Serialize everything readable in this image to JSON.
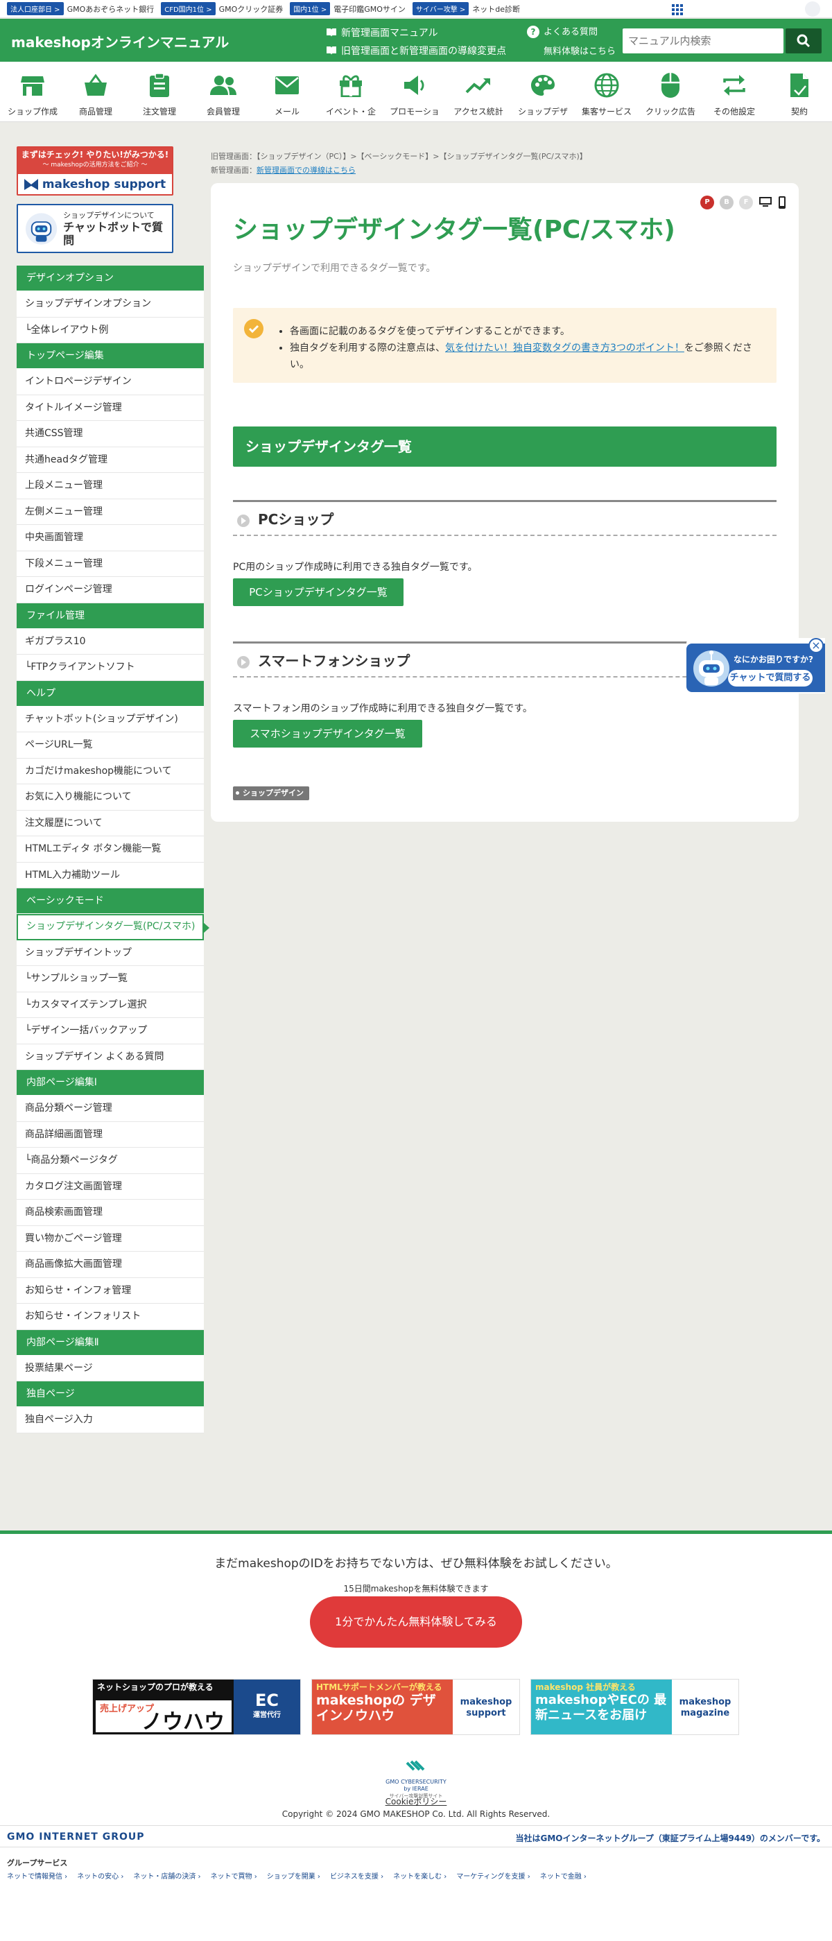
{
  "topbar": {
    "items": [
      {
        "badge": "法人口座部日 >",
        "label": "GMOあおぞらネット銀行"
      },
      {
        "badge": "CFD国内1位 >",
        "label": "GMOクリック証券"
      },
      {
        "badge": "国内1位 >",
        "label": "電子印鑑GMOサイン"
      },
      {
        "badge": "サイバー攻撃 >",
        "label": "ネットde診断"
      }
    ]
  },
  "header": {
    "logo": "makeshopオンラインマニュアル",
    "link1": "新管理画面マニュアル",
    "link2": "旧管理画面と新管理画面の導線変更点",
    "faq": "よくある質問",
    "trial": "無料体験はこちら",
    "search_placeholder": "マニュアル内検索"
  },
  "nav": [
    {
      "label": "ショップ作成",
      "icon": "shop-icon"
    },
    {
      "label": "商品管理",
      "icon": "basket-icon"
    },
    {
      "label": "注文管理",
      "icon": "clipboard-icon"
    },
    {
      "label": "会員管理",
      "icon": "users-icon"
    },
    {
      "label": "メール",
      "icon": "mail-icon"
    },
    {
      "label": "イベント・企",
      "icon": "gift-icon"
    },
    {
      "label": "プロモーショ",
      "icon": "megaphone-icon"
    },
    {
      "label": "アクセス統計",
      "icon": "chart-icon"
    },
    {
      "label": "ショップデザ",
      "icon": "palette-icon"
    },
    {
      "label": "集客サービス",
      "icon": "globe-icon"
    },
    {
      "label": "クリック広告",
      "icon": "mouse-icon"
    },
    {
      "label": "その他設定",
      "icon": "arrows-icon"
    },
    {
      "label": "契約",
      "icon": "document-icon"
    }
  ],
  "banners": {
    "support_top": "まずはチェック! やりたい!がみつかる!",
    "support_sub": "～ makeshopの活用方法をご紹介 ～",
    "support_logo": "makeshop support",
    "chat_line1": "ショップデザインについて",
    "chat_line2": "チャットボットで質問"
  },
  "sidebar": [
    {
      "type": "cat",
      "label": "デザインオプション"
    },
    {
      "type": "it",
      "label": "ショップデザインオプション"
    },
    {
      "type": "it",
      "label": "└全体レイアウト例"
    },
    {
      "type": "cat",
      "label": "トップページ編集"
    },
    {
      "type": "it",
      "label": "イントロページデザイン"
    },
    {
      "type": "it",
      "label": "タイトルイメージ管理"
    },
    {
      "type": "it",
      "label": "共通CSS管理"
    },
    {
      "type": "it",
      "label": "共通headタグ管理"
    },
    {
      "type": "it",
      "label": "上段メニュー管理"
    },
    {
      "type": "it",
      "label": "左側メニュー管理"
    },
    {
      "type": "it",
      "label": "中央画面管理"
    },
    {
      "type": "it",
      "label": "下段メニュー管理"
    },
    {
      "type": "it",
      "label": "ログインページ管理"
    },
    {
      "type": "cat",
      "label": "ファイル管理"
    },
    {
      "type": "it",
      "label": "ギガプラス10"
    },
    {
      "type": "it",
      "label": "└FTPクライアントソフト"
    },
    {
      "type": "cat",
      "label": "ヘルプ"
    },
    {
      "type": "it",
      "label": "チャットボット(ショップデザイン)"
    },
    {
      "type": "it",
      "label": "ページURL一覧"
    },
    {
      "type": "it",
      "label": "カゴだけmakeshop機能について"
    },
    {
      "type": "it",
      "label": "お気に入り機能について"
    },
    {
      "type": "it",
      "label": "注文履歴について"
    },
    {
      "type": "it",
      "label": "HTMLエディタ ボタン機能一覧"
    },
    {
      "type": "it",
      "label": "HTML入力補助ツール"
    },
    {
      "type": "cat",
      "label": "ベーシックモード"
    },
    {
      "type": "act",
      "label": "ショップデザインタグ一覧(PC/スマホ)"
    },
    {
      "type": "it",
      "label": "ショップデザイントップ"
    },
    {
      "type": "it",
      "label": "└サンプルショップ一覧"
    },
    {
      "type": "it",
      "label": "└カスタマイズテンプレ選択"
    },
    {
      "type": "it",
      "label": "└デザイン一括バックアップ"
    },
    {
      "type": "it",
      "label": "ショップデザイン よくある質問"
    },
    {
      "type": "cat",
      "label": "内部ページ編集Ⅰ"
    },
    {
      "type": "it",
      "label": "商品分類ページ管理"
    },
    {
      "type": "it",
      "label": "商品詳細画面管理"
    },
    {
      "type": "it",
      "label": "└商品分類ページタグ"
    },
    {
      "type": "it",
      "label": "カタログ注文画面管理"
    },
    {
      "type": "it",
      "label": "商品検索画面管理"
    },
    {
      "type": "it",
      "label": "買い物かごページ管理"
    },
    {
      "type": "it",
      "label": "商品画像拡大画面管理"
    },
    {
      "type": "it",
      "label": "お知らせ・インフォ管理"
    },
    {
      "type": "it",
      "label": "お知らせ・インフォリスト"
    },
    {
      "type": "cat",
      "label": "内部ページ編集Ⅱ"
    },
    {
      "type": "it",
      "label": "投票結果ページ"
    },
    {
      "type": "cat",
      "label": "独自ページ"
    },
    {
      "type": "it",
      "label": "独自ページ入力"
    }
  ],
  "breadcrumb": {
    "line1": "旧管理画面：【ショップデザイン（PC）】>【ベーシックモード】>【ショップデザインタグ一覧(PC/スマホ)】",
    "line2_prefix": "新管理画面：",
    "line2_link": "新管理画面での導線はこちら"
  },
  "main": {
    "title": "ショップデザインタグ一覧(PC/スマホ)",
    "lead": "ショップデザインで利用できるタグ一覧です。",
    "device_badges": [
      "P",
      "B",
      "F"
    ],
    "notice": {
      "item1": "各画面に記載のあるタグを使ってデザインすることができます。",
      "item2_prefix": "独自タグを利用する際の注意点は、",
      "item2_link": "気を付けたい！独自変数タグの書き方3つのポイント！",
      "item2_suffix": "をご参照ください。"
    },
    "section_title": "ショップデザインタグ一覧",
    "pc": {
      "heading": "PCショップ",
      "text": "PC用のショップ作成時に利用できる独自タグ一覧です。",
      "button": "PCショップデザインタグ一覧"
    },
    "sp": {
      "heading": "スマートフォンショップ",
      "text": "スマートフォン用のショップ作成時に利用できる独自タグ一覧です。",
      "button": "スマホショップデザインタグ一覧"
    },
    "tag": "ショップデザイン"
  },
  "chat_float": {
    "line1": "なにかお困りですか?",
    "line2": "チャットで質問する"
  },
  "footer": {
    "cta1": "まだmakeshopのIDをお持ちでない方は、ぜひ無料体験をお試しください。",
    "cta2": "15日間makeshopを無料体験できます",
    "cta_button": "1分でかんたん無料体験してみる",
    "banner1_top": "ネットショップのプロが教える",
    "banner1_main": "ノウハウ",
    "banner1_side": "売上げアップ",
    "banner1_logo": "EC",
    "banner1_logo_sub": "運営代行",
    "banner2_top": "HTMLサポートメンバーが教える",
    "banner2_main": "makeshopの デザインノウハウ",
    "banner2_logo": "makeshop support",
    "banner3_top": "makeshop 社員が教える",
    "banner3_main": "makeshopやECの 最新ニュースをお届け",
    "banner3_logo": "makeshop magazine",
    "security": "GMO CYBERSECURITY by IERAE",
    "security_sub": "サイバー攻撃対策サイト",
    "cookie": "Cookieポリシー",
    "copyright": "Copyright © 2024 GMO MAKESHOP Co. Ltd. All Rights Reserved.",
    "gmo_logo": "GMO INTERNET GROUP",
    "gmo_right": "当社はGMOインターネットグループ（東証プライム上場9449）のメンバーです。",
    "group_services": "グループサービス",
    "service_links": [
      "ネットで情報発信 ›",
      "ネットの安心 ›",
      "ネット・店舗の決済 ›",
      "ネットで買物 ›",
      "ショップを開業 ›",
      "ビジネスを支援 ›",
      "ネットを楽しむ ›",
      "マーケティングを支援 ›",
      "ネットで金融 ›"
    ]
  }
}
